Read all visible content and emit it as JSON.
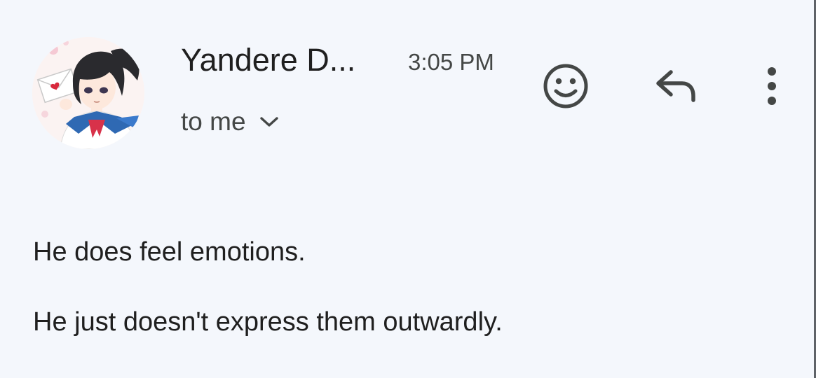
{
  "message": {
    "sender": {
      "name": "Yandere D...",
      "avatar_icon": "anime-schoolgirl-avatar"
    },
    "time": "3:05 PM",
    "recipient": {
      "label": "to me",
      "icon": "chevron-down-icon"
    },
    "actions": [
      {
        "name": "add-reaction",
        "icon": "smiley-icon"
      },
      {
        "name": "reply",
        "icon": "reply-arrow-icon"
      },
      {
        "name": "more-options",
        "icon": "more-vert-icon"
      }
    ],
    "body": [
      "He does feel emotions.",
      "He just doesn't express them outwardly."
    ]
  },
  "colors": {
    "background": "#f4f7fc",
    "text_primary": "#1f1f1f",
    "text_secondary": "#444746",
    "icon": "#444746"
  }
}
